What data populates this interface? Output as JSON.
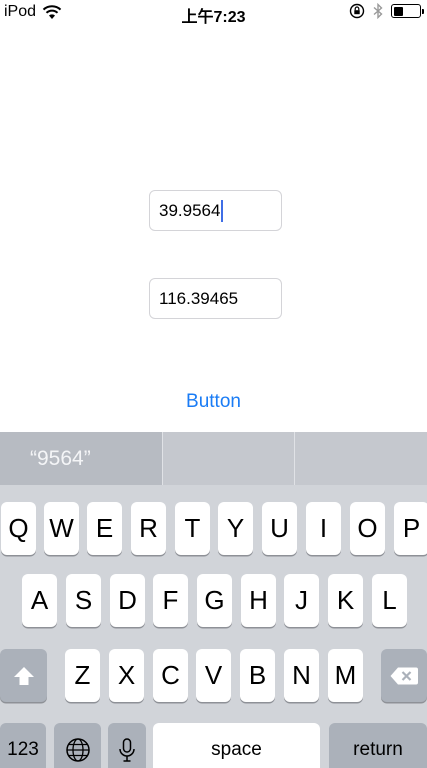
{
  "status_bar": {
    "carrier": "iPod",
    "time": "上午7:23",
    "icons": [
      "wifi-icon",
      "rotation-lock-icon",
      "bluetooth-icon",
      "battery-icon"
    ]
  },
  "form": {
    "latitude_value": "39.9564",
    "longitude_value": "116.39465",
    "button_label": "Button"
  },
  "suggestions": [
    "“9564”",
    "",
    ""
  ],
  "keyboard": {
    "row1": [
      "Q",
      "W",
      "E",
      "R",
      "T",
      "Y",
      "U",
      "I",
      "O",
      "P"
    ],
    "row2": [
      "A",
      "S",
      "D",
      "F",
      "G",
      "H",
      "J",
      "K",
      "L"
    ],
    "row3": [
      "Z",
      "X",
      "C",
      "V",
      "B",
      "N",
      "M"
    ],
    "numbers_label": "123",
    "space_label": "space",
    "return_label": "return",
    "function_icons": [
      "shift-icon",
      "delete-icon",
      "globe-icon",
      "microphone-icon"
    ]
  },
  "colors": {
    "accent": "#1a7cf5",
    "caret": "#3f6ee6",
    "keyboard_bg": "#d1d4d9",
    "suggestion_bg": "#c5c8ce"
  }
}
